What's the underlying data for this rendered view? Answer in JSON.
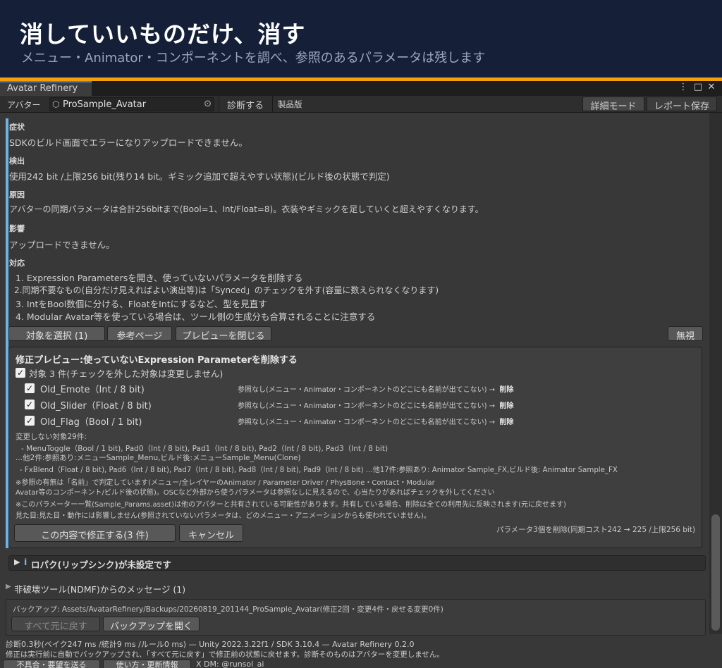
{
  "banner": {
    "title": "消していいものだけ、消す",
    "subtitle": "メニュー・Animator・コンポーネントを調べ、参照のあるパラメータは残します"
  },
  "window": {
    "tab_title": "Avatar Refinery",
    "menu_icon": "⋮",
    "maximize_icon": "□",
    "close_icon": "✕"
  },
  "toolbar": {
    "avatar_label": "アバター",
    "avatar_value": "ProSample_Avatar",
    "diagnose_button": "診断する",
    "edition_label": "製品版",
    "detail_mode_button": "詳細モード",
    "report_save_button": "レポート保存"
  },
  "issue": {
    "symptom_label": "症状",
    "symptom_text": "SDKのビルド画面でエラーになりアップロードできません。",
    "detect_label": "検出",
    "detect_text": "使用242 bit /上限256 bit(残り14 bit。ギミック追加で超えやすい状態)(ビルド後の状態で判定)",
    "cause_label": "原因",
    "cause_text": "アバターの同期パラメータは合計256bitまで(Bool=1、Int/Float=8)。衣装やギミックを足していくと超えやすくなります。",
    "impact_label": "影響",
    "impact_text": "アップロードできません。",
    "fix_label": "対応",
    "fix_steps": [
      "1. Expression Parametersを開き、使っていないパラメータを削除する",
      "2.同期不要なもの(自分だけ見えればよい演出等)は「Synced」のチェックを外す(容量に数えられなくなります)",
      "3. IntをBool数個に分ける、FloatをIntにするなど、型を見直す",
      "4. Modular Avatar等を使っている場合は、ツール側の生成分も合算されることに注意する"
    ],
    "select_target_button": "対象を選択 (1)",
    "reference_button": "参考ページ",
    "close_preview_button": "プレビューを閉じる",
    "ignore_button": "無視"
  },
  "preview": {
    "title": "修正プレビュー:使っていないExpression Parameterを削除する",
    "target_summary": "対象 3 件(チェックを外した対象は変更しません)",
    "items": [
      {
        "name": "Old_Emote（Int / 8 bit)",
        "note": "参照なし(メニュー・Animator・コンポーネントのどこにも名前が出てこない) →",
        "action": "削除",
        "checked": true
      },
      {
        "name": "Old_Slider（Float / 8 bit)",
        "note": "参照なし(メニュー・Animator・コンポーネントのどこにも名前が出てこない) →",
        "action": "削除",
        "checked": true
      },
      {
        "name": "Old_Flag（Bool / 1 bit)",
        "note": "参照なし(メニュー・Animator・コンポーネントのどこにも名前が出てこない) →",
        "action": "削除",
        "checked": true
      }
    ],
    "unchanged_header": "変更しない対象29件:",
    "unchanged_lines": [
      "- MenuToggle（Bool / 1 bit), Pad0（Int / 8 bit), Pad1（Int / 8 bit), Pad2（Int / 8 bit), Pad3（Int / 8 bit)",
      "...他2件:参照あり:メニューSample_Menu,ビルド後:メニューSample_Menu(Clone)",
      "- FxBlend（Float / 8 bit), Pad6（Int / 8 bit), Pad7（Int / 8 bit), Pad8（Int / 8 bit), Pad9（Int / 8 bit) ...他17件:参照あり: Animator Sample_FX,ビルド後: Animator Sample_FX"
    ],
    "notes": [
      "※参照の有無は「名前」で判定しています(メニュー/全レイヤーのAnimator / Parameter Driver / PhysBone・Contact・Modular",
      "Avatar等のコンポーネント/ビルド後の状態)。OSCなど外部から使うパラメータは参照なしに見えるので、心当たりがあればチェックを外してください",
      "※このパラメーター一覧(Sample_Params.asset)は他のアバターと共有されている可能性があります。共有している場合、削除は全ての利用先に反映されます(元に戻せます)",
      "見た目:見た目・動作には影響しません(参照されていないパラメータは、どのメニュー・アニメーションからも使われていません)。"
    ],
    "apply_button": "この内容で修正する(3 件)",
    "cancel_button": "キャンセル",
    "result_summary": "パラメータ3個を削除(同期コスト242 → 225 /上限256 bit)"
  },
  "lipsync": {
    "arrow": "▶",
    "info_icon": "i",
    "text": "ロパク(リップシンク)が未設定です"
  },
  "ndmf": {
    "arrow": "▶",
    "text": "非破壊ツール(NDMF)からのメッセージ (1)"
  },
  "backup": {
    "path_text": "バックアップ: Assets/AvatarRefinery/Backups/20260819_201144_ProSample_Avatar(修正2回・変更4件・戻せる変更0件)",
    "restore_all_button": "すべて元に戻す",
    "open_backup_button": "バックアップを開く"
  },
  "footer": {
    "stats": "診断0.3秒(ベイク247 ms /統計9 ms /ルール0 ms) — Unity 2022.3.22f1 / SDK 3.10.4 — Avatar Refinery 0.2.0",
    "notice": "修正は実行前に自動でバックアップされ、「すべて元に戻す」で修正前の状態に戻せます。診断そのものはアバターを変更しません。",
    "bug_report_button": "不具合・要望を送る",
    "howto_button": "使い方・更新情報",
    "contact": "X DM: @runsol_ai"
  },
  "colors": {
    "banner_bg": "#152038",
    "accent_orange": "#f2a10a",
    "accent_blue": "#6fb3e6",
    "panel_bg": "#383838"
  }
}
